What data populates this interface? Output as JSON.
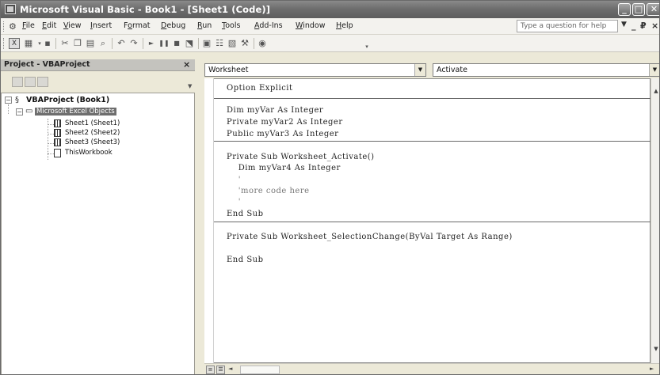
{
  "window": {
    "title": "Microsoft Visual Basic - Book1 - [Sheet1 (Code)]",
    "min_glyph": "_",
    "max_glyph": "□",
    "close_glyph": "✕"
  },
  "menubar": {
    "items": [
      {
        "pre": "",
        "u": "F",
        "post": "ile"
      },
      {
        "pre": "",
        "u": "E",
        "post": "dit"
      },
      {
        "pre": "",
        "u": "V",
        "post": "iew"
      },
      {
        "pre": "",
        "u": "I",
        "post": "nsert"
      },
      {
        "pre": "F",
        "u": "o",
        "post": "rmat"
      },
      {
        "pre": "",
        "u": "D",
        "post": "ebug"
      },
      {
        "pre": "",
        "u": "R",
        "post": "un"
      },
      {
        "pre": "",
        "u": "T",
        "post": "ools"
      },
      {
        "pre": "",
        "u": "A",
        "post": "dd-Ins"
      },
      {
        "pre": "",
        "u": "W",
        "post": "indow"
      },
      {
        "pre": "",
        "u": "H",
        "post": "elp"
      }
    ],
    "help_placeholder": "Type a question for help",
    "doc_min": "_",
    "doc_restore": "₽",
    "doc_close": "×"
  },
  "project_pane": {
    "title": "Project - VBAProject",
    "close": "×",
    "tree": {
      "root": "VBAProject (Book1)",
      "folder": "Microsoft Excel Objects",
      "items": [
        "Sheet1 (Sheet1)",
        "Sheet2 (Sheet2)",
        "Sheet3 (Sheet3)",
        "ThisWorkbook"
      ],
      "expand_glyph": "−"
    }
  },
  "code_pane": {
    "object_combo": "Worksheet",
    "procedure_combo": "Activate",
    "lines": {
      "l1": "Option Explicit",
      "l2": "Dim myVar As Integer",
      "l3": "Private myVar2 As Integer",
      "l4": "Public myVar3 As Integer",
      "l5": "Private Sub Worksheet_Activate()",
      "l6": "    Dim myVar4 As Integer",
      "l7": "    '",
      "l8": "    'more code here",
      "l9": "    '",
      "l10": "End Sub",
      "l11": "Private Sub Worksheet_SelectionChange(ByVal Target As Range)",
      "l12": "End Sub"
    }
  },
  "glyphs": {
    "down": "▼",
    "up": "▲",
    "left": "◄",
    "right": "►"
  }
}
